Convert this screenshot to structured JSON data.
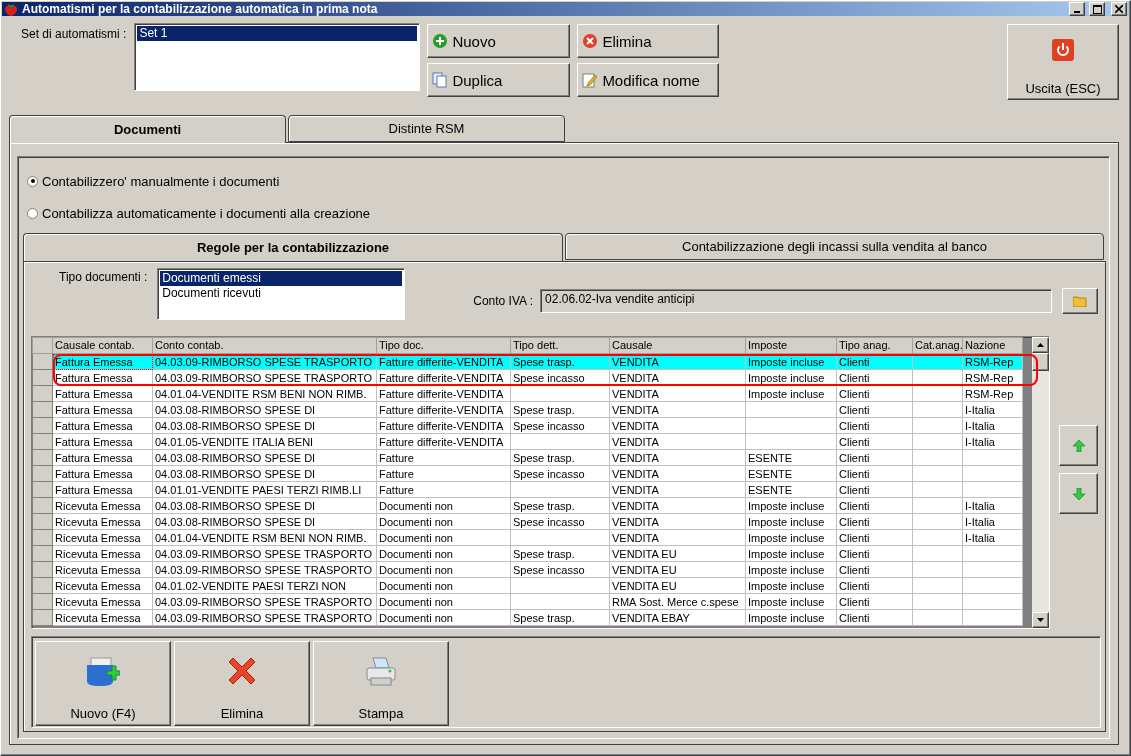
{
  "window": {
    "title": "Automatismi per la contabilizzazione automatica in prima nota"
  },
  "set_selector": {
    "label": "Set di automatismi :",
    "items": [
      {
        "label": "Set 1",
        "selected": true
      }
    ]
  },
  "actions": [
    {
      "label": "Nuovo",
      "kind": "add"
    },
    {
      "label": "Elimina",
      "kind": "delete"
    },
    {
      "label": "Duplica",
      "kind": "copy"
    },
    {
      "label": "Modifica nome",
      "kind": "edit"
    }
  ],
  "exit_button": {
    "label": "Uscita (ESC)"
  },
  "tabs": [
    {
      "label": "Documenti",
      "selected": true
    },
    {
      "label": "Distinte RSM",
      "selected": false
    }
  ],
  "mode_options": [
    {
      "label": "Contabilizzero' manualmente i documenti",
      "selected": true
    },
    {
      "label": "Contabilizza automaticamente i documenti alla creazione",
      "selected": false
    }
  ],
  "inner_tabs": [
    {
      "label": "Regole per la contabilizzazione",
      "selected": true
    },
    {
      "label": "Contabilizzazione degli incassi sulla vendita al banco",
      "selected": false
    }
  ],
  "doc_type": {
    "label": "Tipo documenti :",
    "items": [
      {
        "label": "Documenti emessi",
        "selected": true
      },
      {
        "label": "Documenti ricevuti",
        "selected": false
      }
    ]
  },
  "conto_iva": {
    "label": "Conto IVA :",
    "value": "02.06.02-Iva vendite anticipi"
  },
  "table": {
    "columns": [
      "Causale contab.",
      "Conto contab.",
      "Tipo doc.",
      "Tipo dett.",
      "Causale",
      "Imposte",
      "Tipo anag.",
      "Cat.anag.",
      "Nazione"
    ],
    "rows": [
      {
        "selected": true,
        "outlined": true,
        "cells": [
          "Fattura Emessa",
          "04.03.09-RIMBORSO SPESE TRASPORTO",
          "Fatture differite-VENDITA",
          "Spese trasp.",
          "VENDITA",
          "Imposte incluse",
          "Clienti",
          "",
          "RSM-Rep"
        ]
      },
      {
        "selected": false,
        "outlined": true,
        "cells": [
          "Fattura Emessa",
          "04.03.09-RIMBORSO SPESE TRASPORTO",
          "Fatture differite-VENDITA",
          "Spese incasso",
          "VENDITA",
          "Imposte incluse",
          "Clienti",
          "",
          "RSM-Rep"
        ]
      },
      {
        "selected": false,
        "outlined": false,
        "cells": [
          "Fattura Emessa",
          "04.01.04-VENDITE RSM BENI NON RIMB.",
          "Fatture differite-VENDITA",
          "",
          "VENDITA",
          "Imposte incluse",
          "Clienti",
          "",
          "RSM-Rep"
        ]
      },
      {
        "selected": false,
        "outlined": false,
        "cells": [
          "Fattura Emessa",
          "04.03.08-RIMBORSO SPESE DI",
          "Fatture differite-VENDITA",
          "Spese trasp.",
          "VENDITA",
          "",
          "Clienti",
          "",
          "I-Italia"
        ]
      },
      {
        "selected": false,
        "outlined": false,
        "cells": [
          "Fattura Emessa",
          "04.03.08-RIMBORSO SPESE DI",
          "Fatture differite-VENDITA",
          "Spese incasso",
          "VENDITA",
          "",
          "Clienti",
          "",
          "I-Italia"
        ]
      },
      {
        "selected": false,
        "outlined": false,
        "cells": [
          "Fattura Emessa",
          "04.01.05-VENDITE ITALIA BENI",
          "Fatture differite-VENDITA",
          "",
          "VENDITA",
          "",
          "Clienti",
          "",
          "I-Italia"
        ]
      },
      {
        "selected": false,
        "outlined": false,
        "cells": [
          "Fattura Emessa",
          "04.03.08-RIMBORSO SPESE DI",
          "Fatture",
          "Spese trasp.",
          "VENDITA",
          "ESENTE",
          "Clienti",
          "",
          ""
        ]
      },
      {
        "selected": false,
        "outlined": false,
        "cells": [
          "Fattura Emessa",
          "04.03.08-RIMBORSO SPESE DI",
          "Fatture",
          "Spese incasso",
          "VENDITA",
          "ESENTE",
          "Clienti",
          "",
          ""
        ]
      },
      {
        "selected": false,
        "outlined": false,
        "cells": [
          "Fattura Emessa",
          "04.01.01-VENDITE PAESI TERZI RIMB.LI",
          "Fatture",
          "",
          "VENDITA",
          "ESENTE",
          "Clienti",
          "",
          ""
        ]
      },
      {
        "selected": false,
        "outlined": false,
        "cells": [
          "Ricevuta Emessa",
          "04.03.08-RIMBORSO SPESE DI",
          "Documenti non",
          "Spese trasp.",
          "VENDITA",
          "Imposte incluse",
          "Clienti",
          "",
          "I-Italia"
        ]
      },
      {
        "selected": false,
        "outlined": false,
        "cells": [
          "Ricevuta Emessa",
          "04.03.08-RIMBORSO SPESE DI",
          "Documenti non",
          "Spese incasso",
          "VENDITA",
          "Imposte incluse",
          "Clienti",
          "",
          "I-Italia"
        ]
      },
      {
        "selected": false,
        "outlined": false,
        "cells": [
          "Ricevuta Emessa",
          "04.01.04-VENDITE RSM BENI NON RIMB.",
          "Documenti non",
          "",
          "VENDITA",
          "Imposte incluse",
          "Clienti",
          "",
          "I-Italia"
        ]
      },
      {
        "selected": false,
        "outlined": false,
        "cells": [
          "Ricevuta Emessa",
          "04.03.09-RIMBORSO SPESE TRASPORTO",
          "Documenti non",
          "Spese trasp.",
          "VENDITA EU",
          "Imposte incluse",
          "Clienti",
          "",
          ""
        ]
      },
      {
        "selected": false,
        "outlined": false,
        "cells": [
          "Ricevuta Emessa",
          "04.03.09-RIMBORSO SPESE TRASPORTO",
          "Documenti non",
          "Spese incasso",
          "VENDITA EU",
          "Imposte incluse",
          "Clienti",
          "",
          ""
        ]
      },
      {
        "selected": false,
        "outlined": false,
        "cells": [
          "Ricevuta Emessa",
          "04.01.02-VENDITE PAESI TERZI  NON",
          "Documenti non",
          "",
          "VENDITA EU",
          "Imposte incluse",
          "Clienti",
          "",
          ""
        ]
      },
      {
        "selected": false,
        "outlined": false,
        "cells": [
          "Ricevuta Emessa",
          "04.03.09-RIMBORSO SPESE TRASPORTO",
          "Documenti non",
          "",
          "RMA Sost. Merce c.spese",
          "Imposte incluse",
          "Clienti",
          "",
          ""
        ]
      },
      {
        "selected": false,
        "outlined": false,
        "cells": [
          "Ricevuta Emessa",
          "04.03.09-RIMBORSO SPESE TRASPORTO",
          "Documenti non",
          "Spese trasp.",
          "VENDITA EBAY",
          "Imposte incluse",
          "Clienti",
          "",
          ""
        ]
      }
    ]
  },
  "bottom_buttons": [
    {
      "label": "Nuovo (F4)",
      "kind": "add"
    },
    {
      "label": "Elimina",
      "kind": "delete"
    },
    {
      "label": "Stampa",
      "kind": "print"
    }
  ]
}
